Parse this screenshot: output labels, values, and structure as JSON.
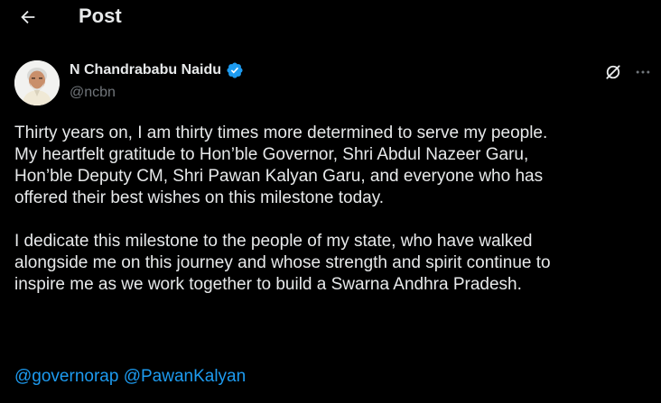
{
  "header": {
    "title": "Post",
    "back_icon": "arrow-left-icon"
  },
  "author": {
    "name": "N Chandrababu Naidu",
    "handle": "@ncbn",
    "verified_icon": "verified-badge-icon",
    "verified_color": "#1d9bf0"
  },
  "actions": {
    "grok_icon": "grok-icon",
    "more_icon": "more-horizontal-icon"
  },
  "post": {
    "paragraphs": [
      {
        "lines": [
          "Thirty years on, I am thirty times more determined to serve my people.",
          "My heartfelt gratitude to Hon’ble Governor, Shri Abdul Nazeer Garu,",
          "Hon’ble Deputy CM, Shri Pawan Kalyan Garu, and everyone who has",
          "offered their best wishes on this milestone today."
        ]
      },
      {
        "lines": [
          "I dedicate this milestone to the people of my state, who have walked",
          "alongside me on this journey and whose strength and spirit continue to",
          "inspire me as we work together to build a Swarna Andhra Pradesh."
        ]
      }
    ],
    "mentions": [
      "@governorap",
      "@PawanKalyan"
    ]
  },
  "colors": {
    "background": "#000000",
    "text": "#e7e9ea",
    "secondary": "#71767b",
    "link": "#1d9bf0"
  }
}
